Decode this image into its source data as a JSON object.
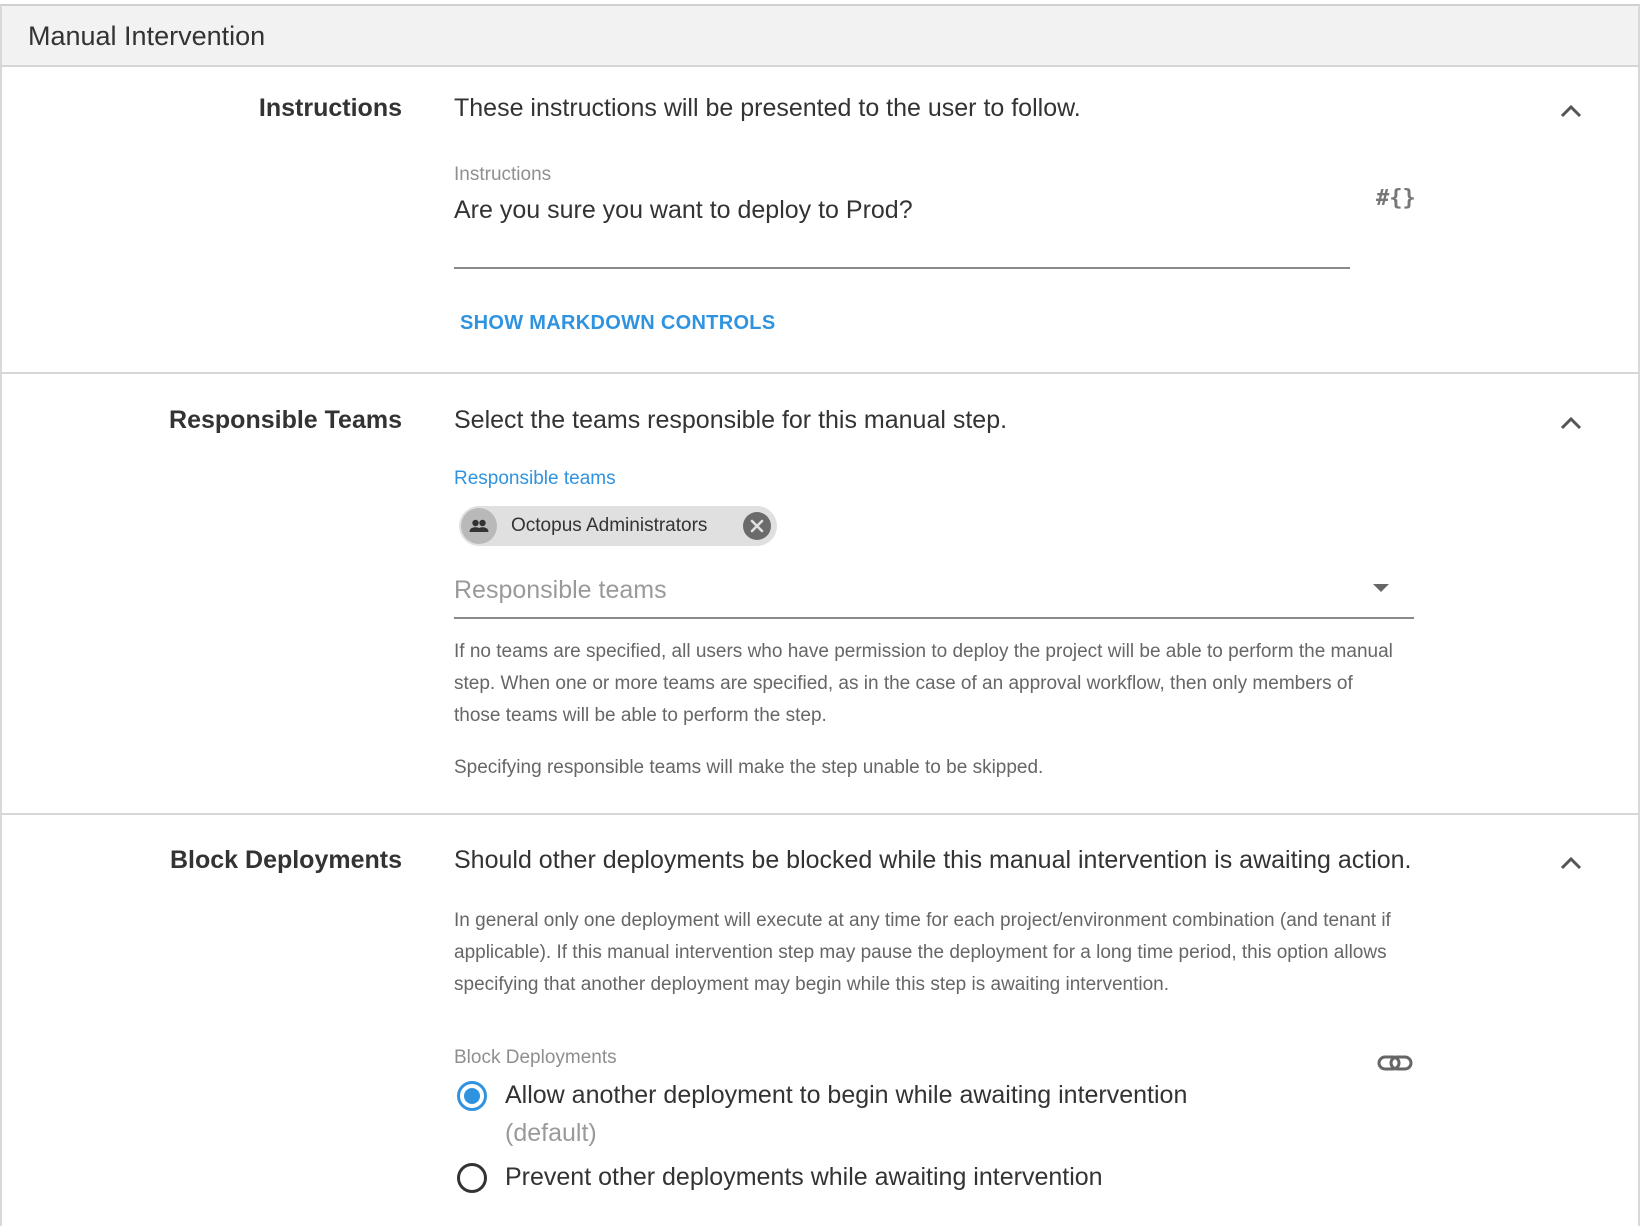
{
  "header": {
    "title": "Manual Intervention"
  },
  "instructions": {
    "label": "Instructions",
    "description": "These instructions will be presented to the user to follow.",
    "field_caption": "Instructions",
    "field_value": "Are you sure you want to deploy to Prod?",
    "variable_icon_text": "#{}",
    "markdown_link": "SHOW MARKDOWN CONTROLS"
  },
  "responsible_teams": {
    "label": "Responsible Teams",
    "description": "Select the teams responsible for this manual step.",
    "field_caption": "Responsible teams",
    "chips": [
      {
        "label": "Octopus Administrators",
        "icon": "team-icon"
      }
    ],
    "select_placeholder": "Responsible teams",
    "help_1": "If no teams are specified, all users who have permission to deploy the project will be able to perform the manual step. When one or more teams are specified, as in the case of an approval workflow, then only members of those teams will be able to perform the step.",
    "help_2": "Specifying responsible teams will make the step unable to be skipped."
  },
  "block_deployments": {
    "label": "Block Deployments",
    "description": "Should other deployments be blocked while this manual intervention is awaiting action.",
    "help": "In general only one deployment will execute at any time for each project/environment combination (and tenant if applicable). If this manual intervention step may pause the deployment for a long time period, this option allows specifying that another deployment may begin while this step is awaiting intervention.",
    "group_caption": "Block Deployments",
    "options": [
      {
        "label": "Allow another deployment to begin while awaiting intervention",
        "hint": "(default)",
        "selected": true
      },
      {
        "label": "Prevent other deployments while awaiting intervention",
        "hint": "",
        "selected": false
      }
    ]
  },
  "colors": {
    "accent": "#2f93e0",
    "header_bg": "#f2f2f2",
    "divider": "#d6d6d6",
    "chip_bg": "#e0e0e0"
  }
}
